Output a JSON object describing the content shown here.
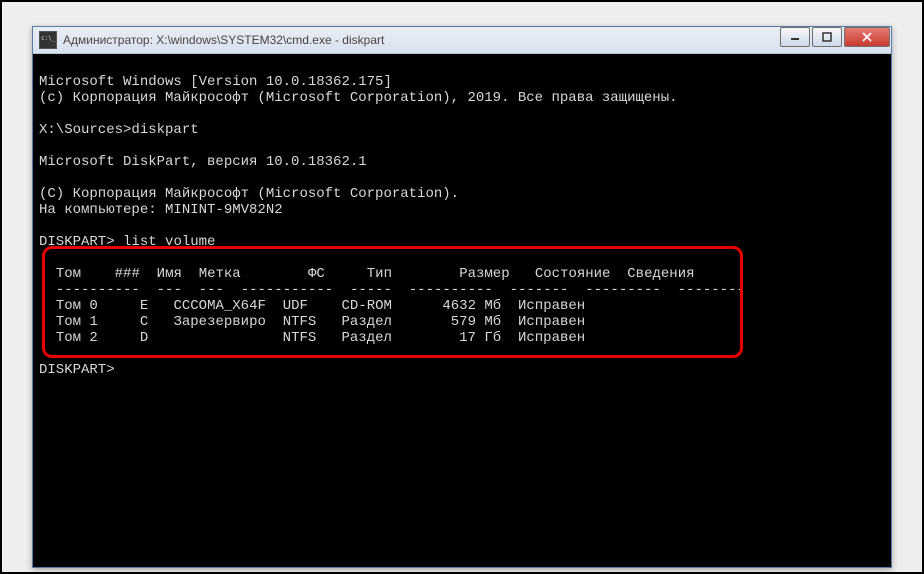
{
  "window": {
    "title": "Администратор: X:\\windows\\SYSTEM32\\cmd.exe - diskpart"
  },
  "console": {
    "line_version": "Microsoft Windows [Version 10.0.18362.175]",
    "line_copyright": "(c) Корпорация Майкрософт (Microsoft Corporation), 2019. Все права защищены.",
    "prompt1_path": "X:\\Sources>",
    "prompt1_cmd": "diskpart",
    "dp_version": "Microsoft DiskPart, версия 10.0.18362.1",
    "dp_copyright": "(C) Корпорация Майкрософт (Microsoft Corporation).",
    "dp_computer": "На компьютере: MININT-9MV82N2",
    "dp_prompt": "DISKPART>",
    "dp_cmd": "list volume",
    "table": {
      "headers": {
        "tom": "Том",
        "num": "###",
        "name": "Имя",
        "label": "Метка",
        "fs": "ФС",
        "type": "Тип",
        "size": "Размер",
        "status": "Состояние",
        "info": "Сведения"
      },
      "sep": {
        "tom": "----------",
        "num": "---",
        "name": "---",
        "label": "-----------",
        "fs": "-----",
        "type": "----------",
        "size": "-------",
        "status": "---------",
        "info": "--------"
      },
      "rows": [
        {
          "tom": "Том 0",
          "name": "E",
          "label": "CCCOMA_X64F",
          "fs": "UDF",
          "type": "CD-ROM",
          "size": "4632 Мб",
          "status": "Исправен"
        },
        {
          "tom": "Том 1",
          "name": "C",
          "label": "Зарезервиро",
          "fs": "NTFS",
          "type": "Раздел",
          "size": " 579 Мб",
          "status": "Исправен"
        },
        {
          "tom": "Том 2",
          "name": "D",
          "label": "",
          "fs": "NTFS",
          "type": "Раздел",
          "size": "  17 Гб",
          "status": "Исправен"
        }
      ]
    }
  },
  "chart_data": {
    "type": "table",
    "title": "list volume",
    "columns": [
      "Том",
      "###",
      "Имя",
      "Метка",
      "ФС",
      "Тип",
      "Размер",
      "Состояние",
      "Сведения"
    ],
    "rows": [
      [
        "Том 0",
        "",
        "E",
        "CCCOMA_X64F",
        "UDF",
        "CD-ROM",
        "4632 Мб",
        "Исправен",
        ""
      ],
      [
        "Том 1",
        "",
        "C",
        "Зарезервиро",
        "NTFS",
        "Раздел",
        "579 Мб",
        "Исправен",
        ""
      ],
      [
        "Том 2",
        "",
        "D",
        "",
        "NTFS",
        "Раздел",
        "17 Гб",
        "Исправен",
        ""
      ]
    ]
  }
}
